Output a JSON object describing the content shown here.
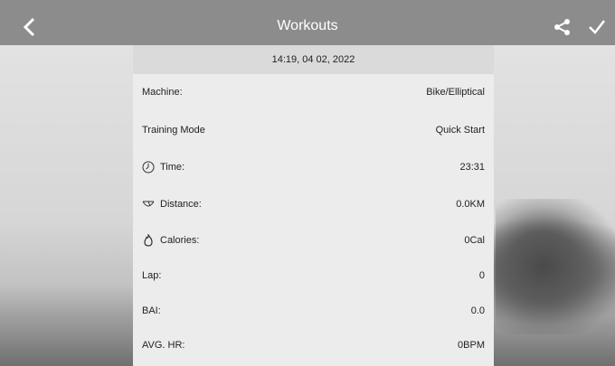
{
  "header": {
    "title": "Workouts",
    "icons": {
      "back": "chevron-left-icon",
      "share": "share-icon",
      "confirm": "check-icon"
    }
  },
  "record": {
    "datetime": "14:19, 04 02, 2022",
    "rows": [
      {
        "label": "Machine:",
        "value": "Bike/Elliptical",
        "icon": ""
      },
      {
        "label": "Training Mode",
        "value": "Quick Start",
        "icon": ""
      },
      {
        "label": "Time:",
        "value": "23:31",
        "icon": "clock-icon"
      },
      {
        "label": "Distance:",
        "value": "0.0KM",
        "icon": "distance-icon"
      },
      {
        "label": "Calories:",
        "value": "0Cal",
        "icon": "flame-icon"
      },
      {
        "label": "Lap:",
        "value": "0",
        "icon": ""
      },
      {
        "label": "BAI:",
        "value": "0.0",
        "icon": ""
      },
      {
        "label": "AVG. HR:",
        "value": "0BPM",
        "icon": ""
      }
    ]
  },
  "colors": {
    "header_bg": "#8c8c8c",
    "panel_bg": "#ececec",
    "date_bar_bg": "#dadada"
  }
}
